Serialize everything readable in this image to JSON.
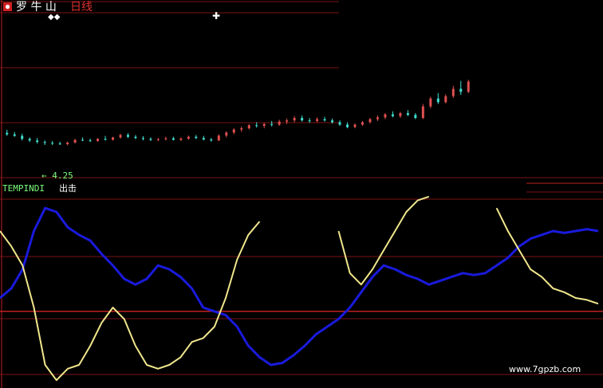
{
  "title": {
    "part1": "罗 牛 山",
    "part2": "日线"
  },
  "indicator_label": {
    "name": "TEMPINDI",
    "suffix": "出击"
  },
  "low_marker": "← 4.25",
  "watermark": "www.7gpzb.com",
  "colors": {
    "up": "#e05050",
    "down": "#40e0d0",
    "flat": "#e8e8e8",
    "blue_line": "#1a1adc",
    "yellow_line": "#f0e68c",
    "grid": "#7a1414",
    "ref_line": "#c02020",
    "title_white": "#ffffff",
    "title_red": "#e03030",
    "label_green": "#7cfc7c"
  },
  "chart_data": [
    {
      "type": "candlestick",
      "title": "罗 牛 山日线",
      "ylim": [
        3.2,
        8.5
      ],
      "candles": [
        [
          4.65,
          4.75,
          4.55,
          4.6
        ],
        [
          4.6,
          4.68,
          4.52,
          4.55
        ],
        [
          4.55,
          4.62,
          4.4,
          4.45
        ],
        [
          4.45,
          4.5,
          4.35,
          4.4
        ],
        [
          4.4,
          4.48,
          4.3,
          4.35
        ],
        [
          4.35,
          4.4,
          4.25,
          4.32
        ],
        [
          4.32,
          4.38,
          4.25,
          4.3
        ],
        [
          4.3,
          4.36,
          4.25,
          4.28
        ],
        [
          4.28,
          4.36,
          4.24,
          4.33
        ],
        [
          4.33,
          4.45,
          4.3,
          4.42
        ],
        [
          4.42,
          4.5,
          4.38,
          4.4
        ],
        [
          4.4,
          4.46,
          4.35,
          4.38
        ],
        [
          4.38,
          4.48,
          4.36,
          4.45
        ],
        [
          4.45,
          4.55,
          4.4,
          4.42
        ],
        [
          4.42,
          4.52,
          4.4,
          4.5
        ],
        [
          4.5,
          4.62,
          4.46,
          4.58
        ],
        [
          4.58,
          4.64,
          4.48,
          4.52
        ],
        [
          4.52,
          4.58,
          4.44,
          4.48
        ],
        [
          4.48,
          4.54,
          4.4,
          4.45
        ],
        [
          4.45,
          4.5,
          4.38,
          4.42
        ],
        [
          4.42,
          4.48,
          4.38,
          4.44
        ],
        [
          4.44,
          4.52,
          4.4,
          4.47
        ],
        [
          4.47,
          4.52,
          4.4,
          4.42
        ],
        [
          4.42,
          4.5,
          4.38,
          4.46
        ],
        [
          4.46,
          4.56,
          4.42,
          4.52
        ],
        [
          4.52,
          4.58,
          4.44,
          4.48
        ],
        [
          4.48,
          4.55,
          4.4,
          4.43
        ],
        [
          4.43,
          4.48,
          4.36,
          4.4
        ],
        [
          4.4,
          4.6,
          4.38,
          4.56
        ],
        [
          4.56,
          4.7,
          4.5,
          4.66
        ],
        [
          4.66,
          4.8,
          4.6,
          4.76
        ],
        [
          4.76,
          4.86,
          4.68,
          4.8
        ],
        [
          4.8,
          4.94,
          4.76,
          4.9
        ],
        [
          4.9,
          5.0,
          4.82,
          4.88
        ],
        [
          4.88,
          4.98,
          4.8,
          4.94
        ],
        [
          4.94,
          5.04,
          4.86,
          4.92
        ],
        [
          4.92,
          5.08,
          4.88,
          5.02
        ],
        [
          5.02,
          5.12,
          4.94,
          5.06
        ],
        [
          5.06,
          5.2,
          5.0,
          5.14
        ],
        [
          5.14,
          5.22,
          5.02,
          5.06
        ],
        [
          5.06,
          5.14,
          4.98,
          5.04
        ],
        [
          5.04,
          5.16,
          5.0,
          5.1
        ],
        [
          5.1,
          5.18,
          5.02,
          5.06
        ],
        [
          5.06,
          5.12,
          4.96,
          5.0
        ],
        [
          5.0,
          5.06,
          4.88,
          4.92
        ],
        [
          4.92,
          5.0,
          4.8,
          4.84
        ],
        [
          4.84,
          4.96,
          4.8,
          4.92
        ],
        [
          4.92,
          5.04,
          4.88,
          5.0
        ],
        [
          5.0,
          5.14,
          4.96,
          5.1
        ],
        [
          5.1,
          5.22,
          5.04,
          5.16
        ],
        [
          5.16,
          5.3,
          5.1,
          5.26
        ],
        [
          5.26,
          5.36,
          5.16,
          5.2
        ],
        [
          5.2,
          5.34,
          5.14,
          5.3
        ],
        [
          5.3,
          5.4,
          5.2,
          5.24
        ],
        [
          5.24,
          5.3,
          5.1,
          5.14
        ],
        [
          5.14,
          5.6,
          5.1,
          5.52
        ],
        [
          5.52,
          5.84,
          5.46,
          5.78
        ],
        [
          5.78,
          5.96,
          5.6,
          5.66
        ],
        [
          5.66,
          5.92,
          5.62,
          5.86
        ],
        [
          5.86,
          6.2,
          5.8,
          6.1
        ],
        [
          6.1,
          6.36,
          5.9,
          6.0
        ],
        [
          6.0,
          6.4,
          5.96,
          6.34
        ]
      ]
    },
    {
      "type": "line",
      "title": "TEMPINDI 出击",
      "ylim": [
        0,
        100
      ],
      "reference_line": 38,
      "series": [
        {
          "color_key": "blue_line",
          "values": [
            45,
            50,
            60,
            80,
            92,
            90,
            82,
            78,
            75,
            68,
            62,
            55,
            52,
            55,
            62,
            60,
            56,
            50,
            40,
            38,
            36,
            30,
            20,
            14,
            10,
            11,
            15,
            20,
            26,
            30,
            34,
            40,
            48,
            56,
            62,
            60,
            57,
            55,
            52,
            54,
            56,
            58,
            57,
            58,
            62,
            66,
            72,
            76,
            78,
            80,
            79,
            80,
            81,
            80
          ]
        },
        {
          "color_key": "yellow_line",
          "values": [
            80,
            72,
            62,
            40,
            10,
            2,
            8,
            10,
            20,
            32,
            40,
            34,
            20,
            10,
            8,
            10,
            14,
            22,
            24,
            30,
            45,
            65,
            78,
            85,
            100,
            100,
            100,
            100,
            100,
            100,
            80,
            58,
            52,
            60,
            70,
            80,
            90,
            96,
            98,
            100,
            100,
            100,
            100,
            100,
            92,
            80,
            70,
            60,
            56,
            50,
            48,
            45,
            44,
            42
          ]
        }
      ]
    }
  ]
}
